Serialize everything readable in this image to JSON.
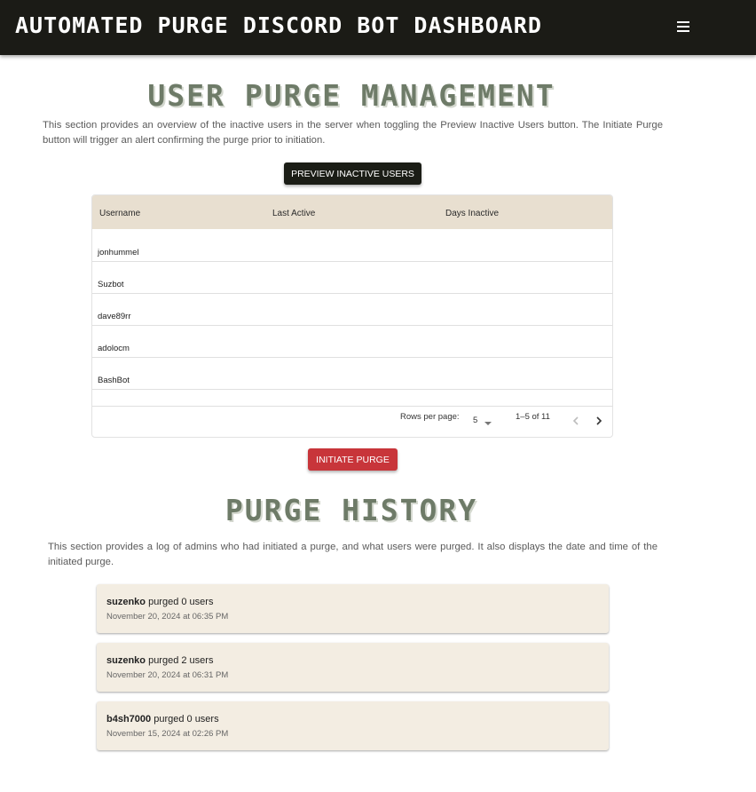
{
  "header": {
    "title": "AUTOMATED PURGE DISCORD BOT DASHBOARD",
    "menu_icon": "hamburger-menu-icon"
  },
  "purge_management": {
    "title": "USER PURGE MANAGEMENT",
    "description": "This section provides an overview of the inactive users in the server when toggling the Preview Inactive Users button. The Initiate Purge button will trigger an alert confirming the purge prior to initiation.",
    "preview_button": "PREVIEW INACTIVE USERS",
    "table": {
      "columns": [
        "Username",
        "Last Active",
        "Days Inactive"
      ],
      "rows": [
        {
          "username": "jonhummel",
          "last_active": "",
          "days_inactive": ""
        },
        {
          "username": "Suzbot",
          "last_active": "",
          "days_inactive": ""
        },
        {
          "username": "dave89rr",
          "last_active": "",
          "days_inactive": ""
        },
        {
          "username": "adolocm",
          "last_active": "",
          "days_inactive": ""
        },
        {
          "username": "BashBot",
          "last_active": "",
          "days_inactive": ""
        }
      ],
      "pagination": {
        "rows_per_page_label": "Rows per page:",
        "rows_per_page": "5",
        "range": "1–5 of 11"
      }
    },
    "purge_button": "INITIATE PURGE",
    "colors": {
      "purge_button": "#c8353a",
      "header_bg": "#1b1b16",
      "table_header_bg": "#e8dfd0"
    }
  },
  "purge_history": {
    "title": "PURGE HISTORY",
    "description": "This section provides a log of admins who had initiated a purge, and what users were purged. It also displays the date and time of the initiated purge.",
    "entries": [
      {
        "admin": "suzenko",
        "action": " purged 0 users",
        "date": "November 20, 2024 at 06:35 PM"
      },
      {
        "admin": "suzenko",
        "action": " purged 2 users",
        "date": "November 20, 2024 at 06:31 PM"
      },
      {
        "admin": "b4sh7000",
        "action": " purged 0 users",
        "date": "November 15, 2024 at 02:26 PM"
      }
    ]
  }
}
